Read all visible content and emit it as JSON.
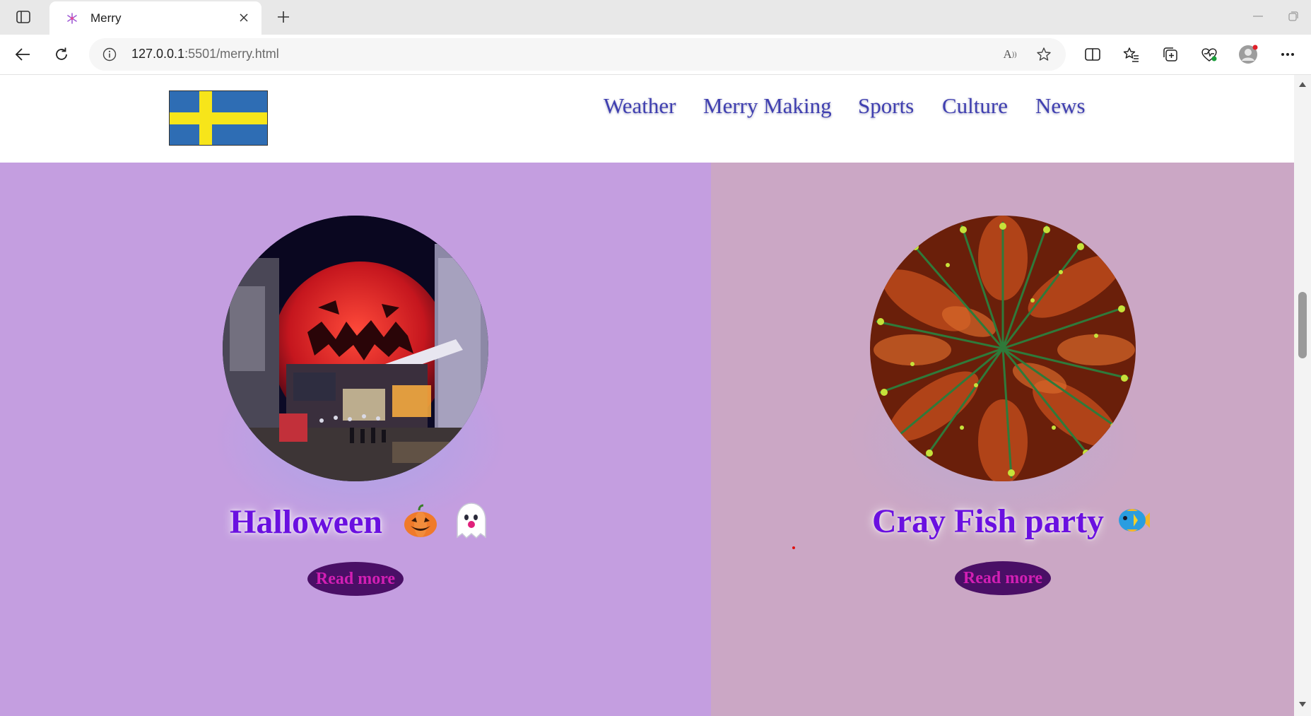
{
  "browser": {
    "tab": {
      "title": "Merry"
    },
    "address": {
      "host": "127.0.0.1",
      "rest": ":5501/merry.html"
    }
  },
  "site": {
    "nav": [
      "Weather",
      "Merry Making",
      "Sports",
      "Culture",
      "News"
    ],
    "cards": [
      {
        "title": "Halloween",
        "emojis": [
          "jack-o-lantern-icon",
          "ghost-icon"
        ],
        "button": "Read more"
      },
      {
        "title": "Cray Fish party",
        "emojis": [
          "fish-icon"
        ],
        "button": "Read more"
      }
    ]
  },
  "colors": {
    "panel_left": "#c49ee0",
    "panel_right": "#cba7c5",
    "title": "#6a10e0",
    "button_bg": "#4a0f66",
    "button_text": "#d21fb4",
    "nav": "#3f3fb0"
  }
}
